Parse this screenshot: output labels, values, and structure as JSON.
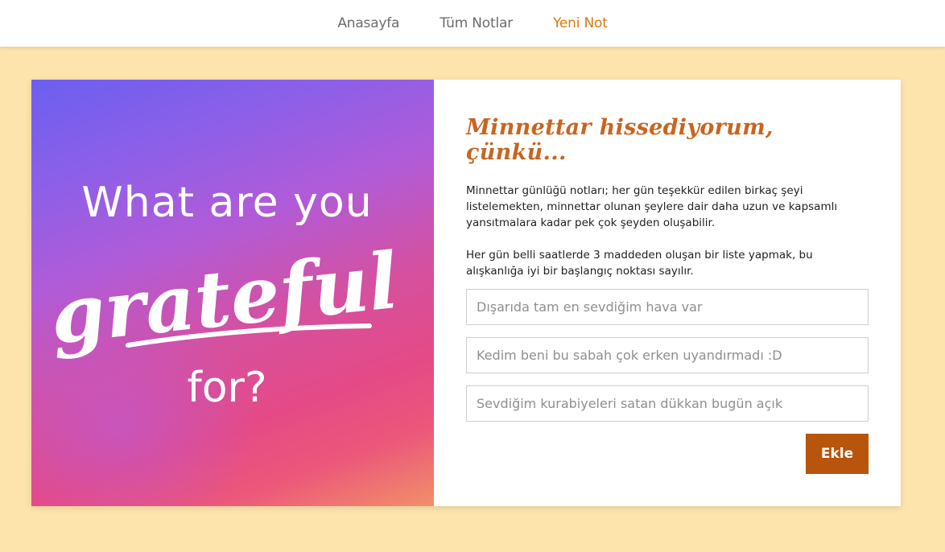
{
  "nav": {
    "items": [
      {
        "label": "Anasayfa",
        "active": false
      },
      {
        "label": "Tüm Notlar",
        "active": false
      },
      {
        "label": "Yeni Not",
        "active": true
      }
    ],
    "active_color": "#d9780f"
  },
  "hero": {
    "line1": "What are you",
    "line2": "grateful",
    "line3": "for?"
  },
  "panel": {
    "title": "Minnettar hissediyorum, çünkü...",
    "paragraph1": "Minnettar günlüğü notları; her gün teşekkür edilen birkaç şeyi listelemekten, minnettar olunan şeylere dair daha uzun ve kapsamlı yansıtmalara kadar pek çok şeyden oluşabilir.",
    "paragraph2": "Her gün belli saatlerde 3 maddeden oluşan bir liste yapmak, bu alışkanlığa iyi bir başlangıç noktası sayılır.",
    "inputs": [
      {
        "placeholder": "Dışarıda tam en sevdiğim hava var",
        "value": ""
      },
      {
        "placeholder": "Kedim beni bu sabah çok erken uyandırmadı :D",
        "value": ""
      },
      {
        "placeholder": "Sevdiğim kurabiyeleri satan dükkan bugün açık",
        "value": ""
      }
    ],
    "add_label": "Ekle"
  },
  "colors": {
    "background": "#fde4ad",
    "accent": "#c9651f",
    "button": "#b8540c"
  }
}
